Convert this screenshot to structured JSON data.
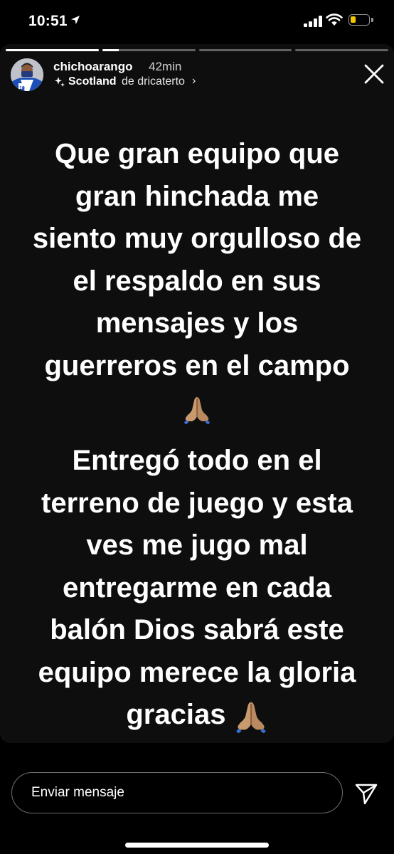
{
  "status_bar": {
    "time": "10:51",
    "icons": [
      "location-arrow-icon",
      "signal-bars-icon",
      "wifi-icon",
      "battery-icon"
    ],
    "battery_level": 0.3,
    "battery_color": "#f2c500"
  },
  "story": {
    "progress": [
      1,
      0.18,
      0,
      0
    ],
    "header": {
      "username": "chichoarango",
      "time_ago": "42min",
      "location_place": "Scotland",
      "location_by": "de dricaterto",
      "chevron": "›"
    },
    "text_block_1": [
      "Que gran equipo que",
      "gran hinchada me",
      "siento muy orgulloso de",
      "el respaldo en sus",
      "mensajes y los",
      "guerreros en el campo"
    ],
    "text_block_2": [
      "Entregó todo en el",
      "terreno de juego y esta",
      "ves me jugo mal",
      "entregarme en cada",
      "balón Dios sabrá este",
      "equipo merece la gloria"
    ],
    "text_block_2_last": "gracias",
    "emoji_name": "folded-hands-icon"
  },
  "reply": {
    "placeholder": "Enviar mensaje"
  },
  "colors": {
    "background": "#000000",
    "story_background": "#0e0e0e",
    "text": "#ffffff"
  }
}
